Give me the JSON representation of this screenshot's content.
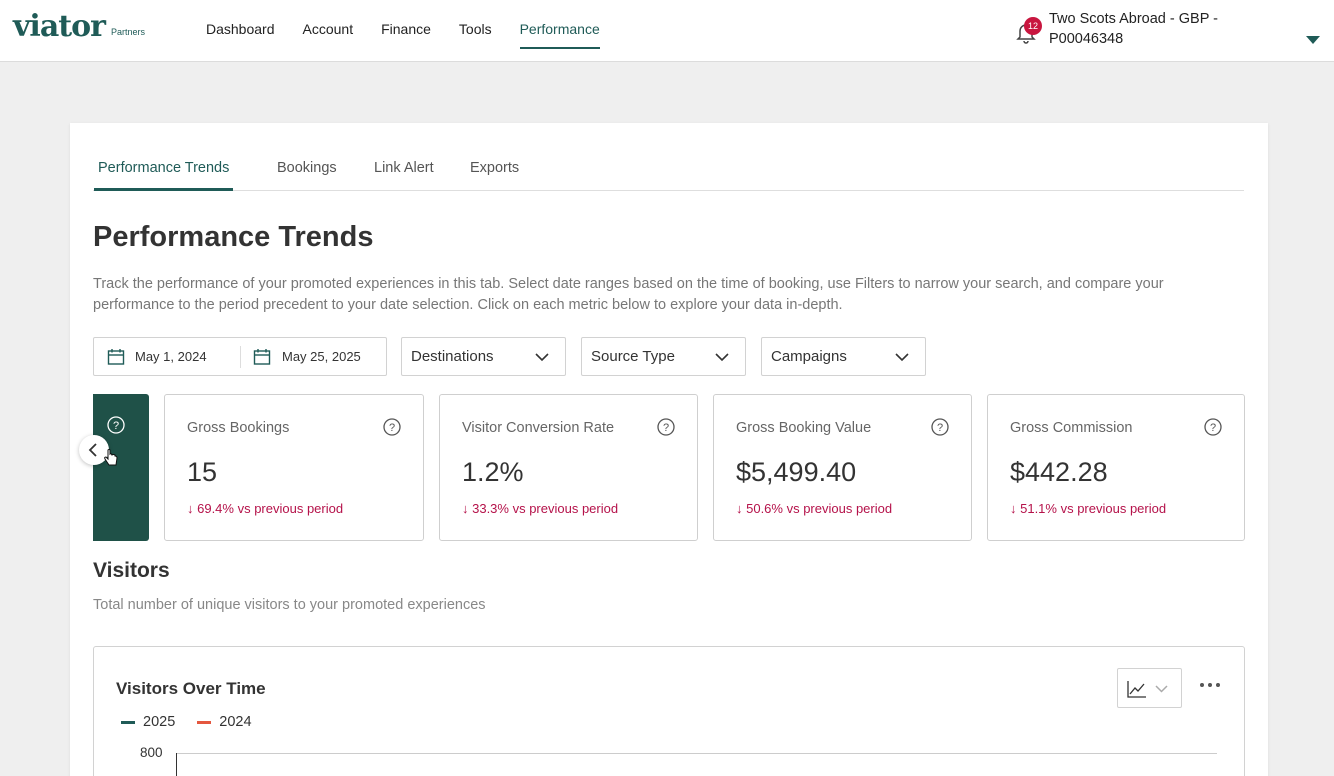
{
  "brand": {
    "logo": "viator",
    "logo_sub": "Partners",
    "primary_color": "#1f5b57",
    "alert_color": "#b5124a"
  },
  "nav": {
    "items": [
      "Dashboard",
      "Account",
      "Finance",
      "Tools",
      "Performance"
    ],
    "active": "Performance"
  },
  "header": {
    "notification_count": "12",
    "account_name": "Two Scots Abroad - GBP - P00046348"
  },
  "tabs": [
    "Performance Trends",
    "Bookings",
    "Link Alert",
    "Exports"
  ],
  "page": {
    "title": "Performance Trends",
    "description": "Track the performance of your promoted experiences in this tab. Select date ranges based on the time of booking, use Filters to narrow your search, and compare your performance to the period precedent to your date selection. Click on each metric below to explore your data in-depth."
  },
  "filters": {
    "start_date": "May 1, 2024",
    "end_date": "May 25, 2025",
    "dropdowns": [
      "Destinations",
      "Source Type",
      "Campaigns"
    ]
  },
  "metrics": [
    {
      "title": "Gross Bookings",
      "value": "15",
      "change": "↓ 69.4% vs previous period"
    },
    {
      "title": "Visitor Conversion Rate",
      "value": "1.2%",
      "change": "↓ 33.3% vs previous period"
    },
    {
      "title": "Gross Booking Value",
      "value": "$5,499.40",
      "change": "↓ 50.6% vs previous period"
    },
    {
      "title": "Gross Commission",
      "value": "$442.28",
      "change": "↓ 51.1% vs previous period"
    }
  ],
  "visitors": {
    "title": "Visitors",
    "description": "Total number of unique visitors to your promoted experiences"
  },
  "chart": {
    "title": "Visitors Over Time",
    "legend": [
      {
        "name": "2025",
        "color": "#1f5b57"
      },
      {
        "name": "2024",
        "color": "#e4573f"
      }
    ],
    "y_tick_top": "800"
  }
}
